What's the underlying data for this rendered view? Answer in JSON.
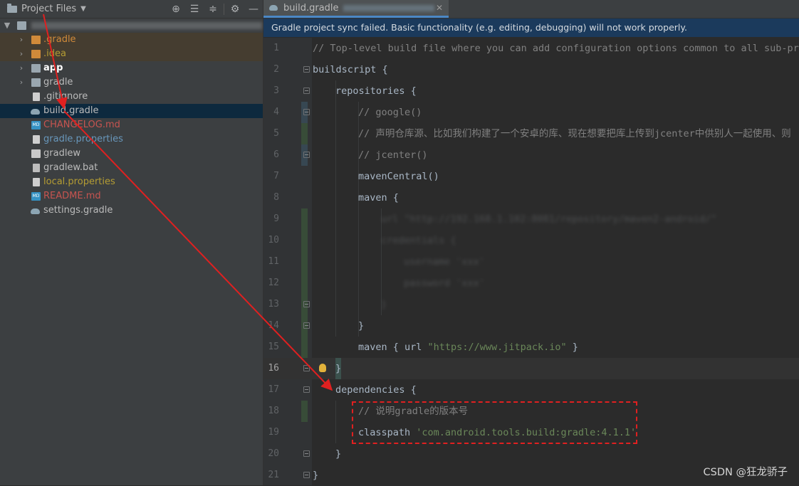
{
  "project_panel": {
    "title": "Project Files",
    "tool_icons": [
      "locate-icon",
      "expand-all-icon",
      "collapse-all-icon",
      "settings-icon",
      "hide-icon"
    ],
    "tree": [
      {
        "label": "",
        "kind": "root-folder",
        "color": "#bbbbbb"
      },
      {
        "label": ".gradle",
        "kind": "folder-orange",
        "color": "#d08a3a"
      },
      {
        "label": ".idea",
        "kind": "folder-orange",
        "color": "#b59d33"
      },
      {
        "label": "app",
        "kind": "folder",
        "color": "#ffffff"
      },
      {
        "label": "gradle",
        "kind": "folder",
        "color": "#bbbbbb"
      },
      {
        "label": ".gitignore",
        "kind": "file",
        "color": "#bbbbbb"
      },
      {
        "label": "build.gradle",
        "kind": "gradle",
        "color": "#bbbbbb"
      },
      {
        "label": "CHANGELOG.md",
        "kind": "md",
        "color": "#c75450"
      },
      {
        "label": "gradle.properties",
        "kind": "file",
        "color": "#6897bb"
      },
      {
        "label": "gradlew",
        "kind": "term",
        "color": "#bbbbbb"
      },
      {
        "label": "gradlew.bat",
        "kind": "bat",
        "color": "#bbbbbb"
      },
      {
        "label": "local.properties",
        "kind": "file",
        "color": "#b59d33"
      },
      {
        "label": "README.md",
        "kind": "md",
        "color": "#c75450"
      },
      {
        "label": "settings.gradle",
        "kind": "gradle",
        "color": "#bbbbbb"
      }
    ]
  },
  "editor": {
    "tab_label": "build.gradle",
    "banner": "Gradle project sync failed. Basic functionality (e.g. editing, debugging) will not work properly.",
    "current_line": 16,
    "lines": [
      {
        "n": "1",
        "text": "// Top-level build file where you can add configuration options common to all sub-proj"
      },
      {
        "n": "2",
        "text": "buildscript {"
      },
      {
        "n": "3",
        "text": "repositories {"
      },
      {
        "n": "4",
        "text": "// google()"
      },
      {
        "n": "5",
        "text": "// 声明仓库源、比如我们构建了一个安卓的库、现在想要把库上传到jcenter中供别人一起使用、则"
      },
      {
        "n": "6",
        "text": "// jcenter()"
      },
      {
        "n": "7",
        "text": "mavenCentral()"
      },
      {
        "n": "8",
        "text": "maven {"
      },
      {
        "n": "9",
        "text": ""
      },
      {
        "n": "10",
        "text": ""
      },
      {
        "n": "11",
        "text": ""
      },
      {
        "n": "12",
        "text": ""
      },
      {
        "n": "13",
        "text": ""
      },
      {
        "n": "14",
        "text": "}"
      },
      {
        "n": "15",
        "text_kw": "maven { url ",
        "text_str": "\"https://www.jitpack.io\"",
        "text_end": " }"
      },
      {
        "n": "16",
        "text": "}"
      },
      {
        "n": "17",
        "text": "dependencies {"
      },
      {
        "n": "18",
        "text": "// 说明gradle的版本号"
      },
      {
        "n": "19",
        "text_kw": "classpath ",
        "text_str": "'com.android.tools.build:gradle:4.1.1'"
      },
      {
        "n": "20",
        "text": "}"
      },
      {
        "n": "21",
        "text": "}"
      }
    ]
  },
  "watermark": "CSDN @狂龙骄子",
  "colors": {
    "accent": "#4a88c7",
    "banner_bg": "#1b3a5c",
    "annotation_red": "#e02020",
    "string": "#6a8759",
    "comment": "#808080"
  }
}
